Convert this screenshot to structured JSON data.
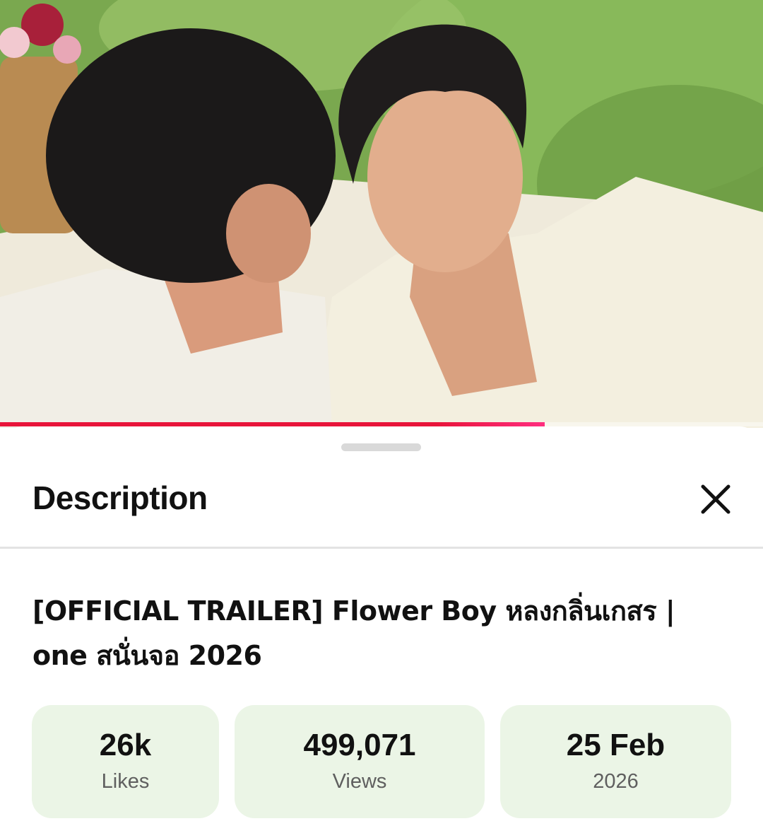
{
  "player": {
    "progress": 0.714
  },
  "sheet": {
    "title": "Description",
    "close_icon": "close-icon"
  },
  "video": {
    "title": "[OFFICIAL TRAILER] Flower Boy หลงกลิ่นเกสร | one สนั่นจอ 2026"
  },
  "stats": {
    "likes": {
      "value": "26k",
      "label": "Likes"
    },
    "views": {
      "value": "499,071",
      "label": "Views"
    },
    "date": {
      "value": "25 Feb",
      "label": "2026"
    }
  },
  "colors": {
    "progress": "#e8143a",
    "stat_card_bg": "#ebf5e6",
    "text_primary": "#111111",
    "text_secondary": "#5f5f5f"
  }
}
